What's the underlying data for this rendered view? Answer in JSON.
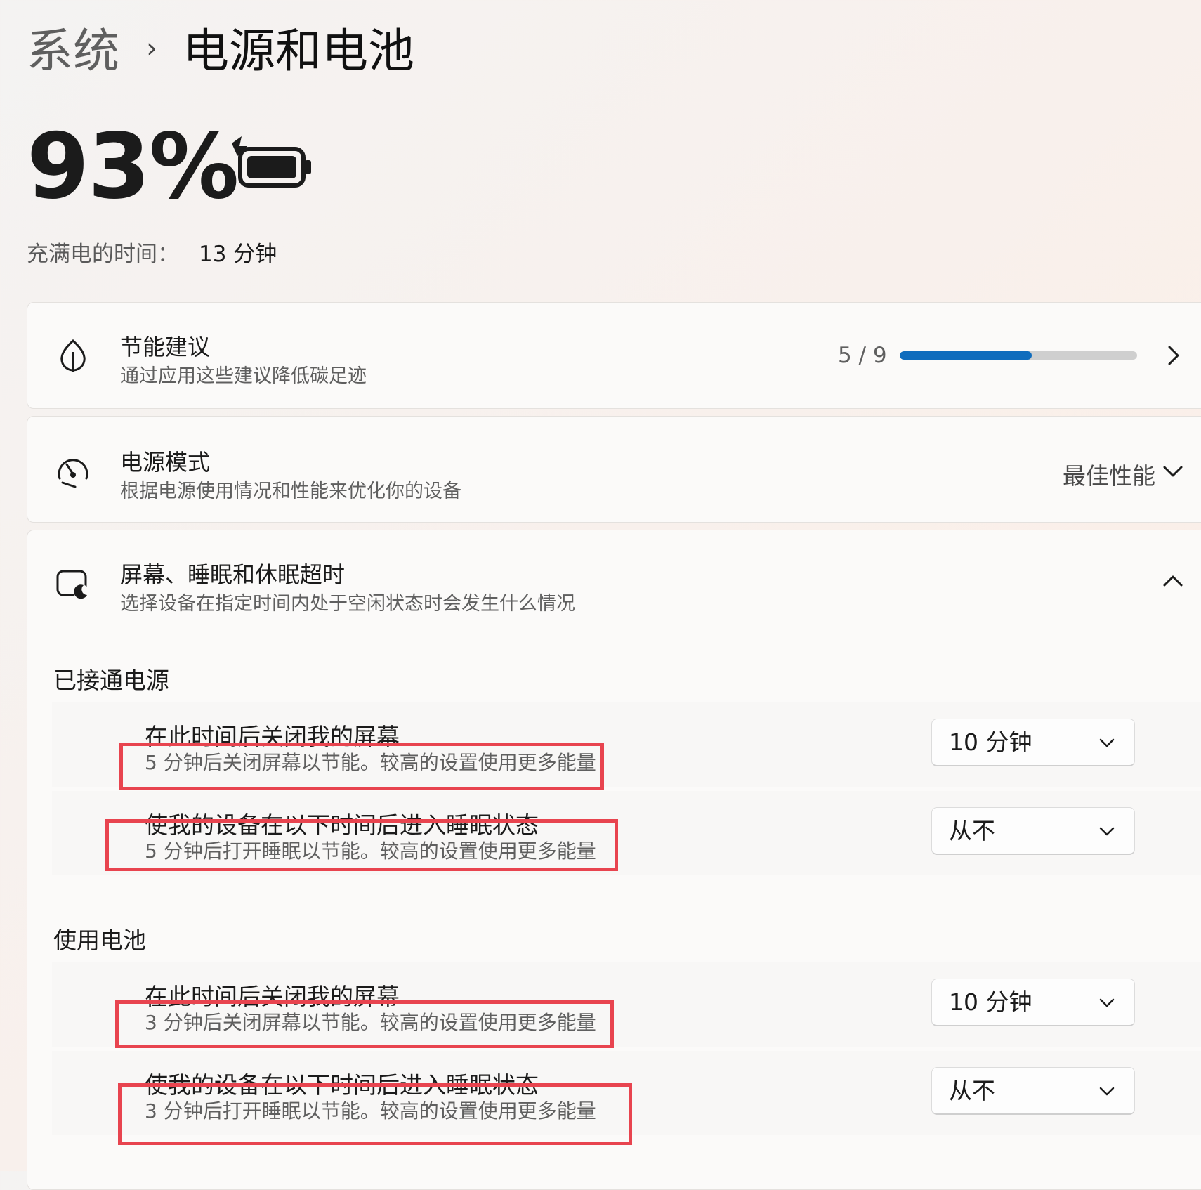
{
  "header": {
    "breadcrumb_parent": "系统",
    "breadcrumb_separator": "›",
    "breadcrumb_current": "电源和电池"
  },
  "battery": {
    "percent_text": "93%",
    "charging": true,
    "icon": "battery-charging-icon",
    "time_to_full_label": "充满电的时间：",
    "time_to_full_value": "13 分钟"
  },
  "energy_recommendations": {
    "icon": "leaf-icon",
    "title": "节能建议",
    "subtitle": "通过应用这些建议降低碳足迹",
    "progress_text": "5 / 9",
    "progress_done": 5,
    "progress_total": 9,
    "accent_color": "#0f6cbd"
  },
  "power_mode": {
    "icon": "speedometer-icon",
    "title": "电源模式",
    "subtitle": "根据电源使用情况和性能来优化你的设备",
    "value": "最佳性能"
  },
  "screen_sleep": {
    "icon": "screen-sleep-icon",
    "title": "屏幕、睡眠和休眠超时",
    "subtitle": "选择设备在指定时间内处于空闲状态时会发生什么情况",
    "expanded": true,
    "plugged_in": {
      "label": "已接通电源",
      "screen_off": {
        "title": "在此时间后关闭我的屏幕",
        "subtitle": "5 分钟后关闭屏幕以节能。较高的设置使用更多能量",
        "value": "10 分钟"
      },
      "sleep": {
        "title": "使我的设备在以下时间后进入睡眠状态",
        "subtitle": "5 分钟后打开睡眠以节能。较高的设置使用更多能量",
        "value": "从不"
      }
    },
    "on_battery": {
      "label": "使用电池",
      "screen_off": {
        "title": "在此时间后关闭我的屏幕",
        "subtitle": "3 分钟后关闭屏幕以节能。较高的设置使用更多能量",
        "value": "10 分钟"
      },
      "sleep": {
        "title": "使我的设备在以下时间后进入睡眠状态",
        "subtitle": "3 分钟后打开睡眠以节能。较高的设置使用更多能量",
        "value": "从不"
      }
    }
  },
  "highlight_color": "#e8444f"
}
